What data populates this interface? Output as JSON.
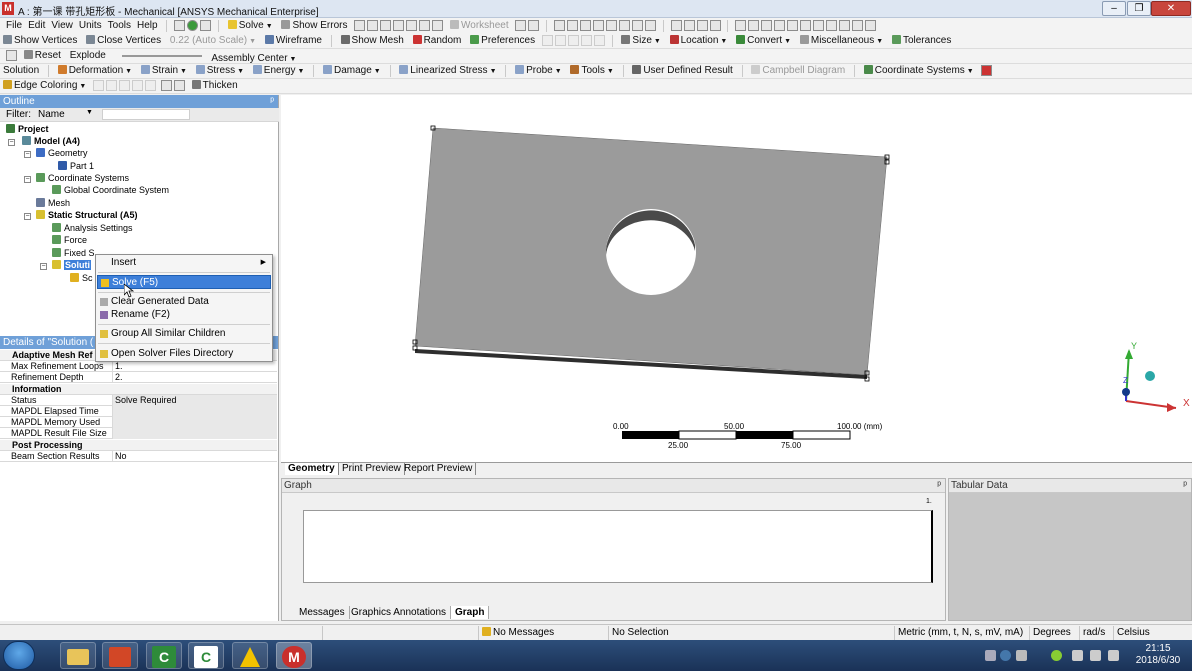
{
  "window": {
    "title": "A : 第一课 带孔矩形板 - Mechanical [ANSYS Mechanical Enterprise]",
    "logo_letter": "M",
    "minimize": "–",
    "restore": "❐",
    "close": "✕"
  },
  "menu": [
    "File",
    "Edit",
    "View",
    "Units",
    "Tools",
    "Help"
  ],
  "toolbar1": {
    "solve": "Solve",
    "show_errors": "Show Errors",
    "worksheet": "Worksheet"
  },
  "toolbar2": {
    "show_vertices": "Show Vertices",
    "close_vertices": "Close Vertices",
    "auto_scale": "0.22 (Auto Scale)",
    "wireframe": "Wireframe",
    "show_mesh": "Show Mesh",
    "random": "Random",
    "preferences": "Preferences",
    "size": "Size",
    "location": "Location",
    "convert": "Convert",
    "miscellaneous": "Miscellaneous",
    "tolerances": "Tolerances"
  },
  "toolbar3": {
    "reset": "Reset",
    "explode": "Explode",
    "assembly_center": "Assembly Center"
  },
  "toolbar4": {
    "solution": "Solution",
    "items": [
      "Deformation",
      "Strain",
      "Stress",
      "Energy",
      "Damage",
      "Linearized Stress",
      "Probe",
      "Tools"
    ],
    "user_defined_result": "User Defined Result",
    "campbell_diagram": "Campbell Diagram",
    "coordinate_systems": "Coordinate Systems"
  },
  "toolbar5": {
    "edge_coloring": "Edge Coloring",
    "thicken": "Thicken"
  },
  "outline": {
    "title": "Outline",
    "pin": "ᵖ",
    "filter_label": "Filter:",
    "filter_value": "Name",
    "tree": {
      "project": "Project",
      "model": "Model (A4)",
      "geometry": "Geometry",
      "part1": "Part 1",
      "coordinate_systems": "Coordinate Systems",
      "global_cs": "Global Coordinate System",
      "mesh": "Mesh",
      "static_structural": "Static Structural (A5)",
      "analysis_settings": "Analysis Settings",
      "force": "Force",
      "fixed_support": "Fixed S",
      "solution": "Soluti",
      "solution_info": "Sc"
    }
  },
  "context_menu": {
    "insert": "Insert",
    "solve": "Solve (F5)",
    "clear": "Clear Generated Data",
    "rename": "Rename (F2)",
    "group": "Group All Similar Children",
    "open_dir": "Open Solver Files Directory"
  },
  "details": {
    "title": "Details of \"Solution (",
    "rows": [
      {
        "k": "Adaptive Mesh Ref",
        "v": "",
        "group": true
      },
      {
        "k": "Max Refinement Loops",
        "v": "1."
      },
      {
        "k": "Refinement Depth",
        "v": "2."
      },
      {
        "k": "Information",
        "v": "",
        "group": true
      },
      {
        "k": "Status",
        "v": "Solve Required",
        "grey": true
      },
      {
        "k": "MAPDL Elapsed Time",
        "v": "",
        "grey": true
      },
      {
        "k": "MAPDL Memory Used",
        "v": "",
        "grey": true
      },
      {
        "k": "MAPDL Result File Size",
        "v": "",
        "grey": true
      },
      {
        "k": "Post Processing",
        "v": "",
        "group": true
      },
      {
        "k": "Beam Section Results",
        "v": "No"
      }
    ]
  },
  "scale": {
    "t0": "0.00",
    "t50": "50.00",
    "t100": "100.00 (mm)",
    "t25": "25.00",
    "t75": "75.00"
  },
  "triad": {
    "x": "X",
    "y": "Y",
    "z": "Z"
  },
  "view_tabs": [
    "Geometry",
    "Print Preview",
    "Report Preview"
  ],
  "graph": {
    "title": "Graph",
    "axis_max": "1."
  },
  "tabular": {
    "title": "Tabular Data"
  },
  "graph_tabs": [
    "Messages",
    "Graphics Annotations",
    "Graph"
  ],
  "status": {
    "messages": "No Messages",
    "selection": "No Selection",
    "units": "Metric (mm, t, N, s, mV, mA)",
    "angle": "Degrees",
    "rate": "rad/s",
    "temp": "Celsius"
  },
  "taskbar": {
    "time": "21:15",
    "date": "2018/6/30",
    "apps": [
      "C",
      "C",
      "M"
    ]
  }
}
